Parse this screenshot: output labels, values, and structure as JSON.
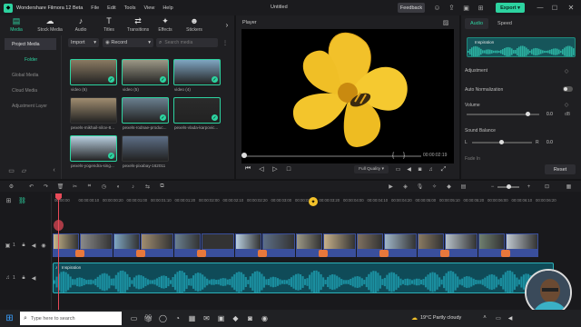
{
  "app": {
    "name": "Wondershare Filmora 12 Beta",
    "doc_title": "Untitled",
    "feedback": "Feedback",
    "export": "Export"
  },
  "menu": [
    "File",
    "Edit",
    "Tools",
    "View",
    "Help"
  ],
  "tabs": [
    {
      "label": "Media",
      "glyph": "▤"
    },
    {
      "label": "Stock Media",
      "glyph": "☁"
    },
    {
      "label": "Audio",
      "glyph": "♪"
    },
    {
      "label": "Titles",
      "glyph": "T"
    },
    {
      "label": "Transitions",
      "glyph": "⇄"
    },
    {
      "label": "Effects",
      "glyph": "✦"
    },
    {
      "label": "Stickers",
      "glyph": "☻"
    }
  ],
  "sidebar": {
    "project_media": "Project Media",
    "folder": "Folder",
    "global_media": "Global Media",
    "cloud_media": "Cloud Media",
    "adjustment_layer": "Adjustment Layer"
  },
  "media_toolbar": {
    "import": "Import",
    "record": "Record",
    "search_placeholder": "Search media"
  },
  "media": [
    {
      "caption": "video (6)",
      "selected": true,
      "color": "#8a7a62"
    },
    {
      "caption": "video (5)",
      "selected": true,
      "color": "#9c9886"
    },
    {
      "caption": "video (4)",
      "selected": true,
      "color": "#7fa6c2"
    },
    {
      "caption": "pexels-mikhail-nilov-8...",
      "selected": false,
      "color": "#a08d70"
    },
    {
      "caption": "pexels-rodnae-produc...",
      "selected": true,
      "color": "#6a7f8f"
    },
    {
      "caption": "pexels-vlada-karpovic...",
      "selected": true,
      "color": "#2b2b2b"
    },
    {
      "caption": "pexels-yogendra-sing...",
      "selected": true,
      "color": "#b9cfe0"
    },
    {
      "caption": "pexels-pixabay-162011",
      "selected": false,
      "color": "#5d6e86"
    }
  ],
  "player": {
    "label": "Player",
    "timecode": "00:00:02:19",
    "quality": "Full Quality"
  },
  "right": {
    "tabs": [
      "Audio",
      "Speed"
    ],
    "clip_name": "Inspiration",
    "adjustment": "Adjustment",
    "auto_normalization": "Auto Normalization",
    "volume": "Volume",
    "volume_value": "0.0",
    "volume_unit": "dB",
    "sound_balance": "Sound Balance",
    "balance_left": "L",
    "balance_right": "R",
    "balance_value": "0.0",
    "fade_in": "Fade In",
    "reset": "Reset"
  },
  "ruler": [
    "00:00:00",
    "00:00:00:10",
    "00:00:00:20",
    "00:00:01:00",
    "00:00:01:10",
    "00:00:01:20",
    "00:00:02:00",
    "00:00:02:10",
    "00:00:02:20",
    "00:00:03:00",
    "00:00:03:10",
    "00:00:03:20",
    "00:00:04:00",
    "00:00:04:10",
    "00:00:04:20",
    "00:00:05:00",
    "00:00:05:10",
    "00:00:05:20",
    "00:00:06:00",
    "00:00:06:10",
    "00:00:06:20"
  ],
  "tracks": {
    "video_label": "1",
    "audio_label": "1",
    "audio_clip": "Inspiration"
  },
  "taskbar": {
    "search_placeholder": "Type here to search",
    "weather": "19°C  Partly cloudy"
  },
  "colors": {
    "accent": "#2dd3a0",
    "audio_wave": "#1b8fa0",
    "audio_bg": "#0f4b58",
    "video_clip": "#3a4f9c",
    "transition": "#e8783c",
    "export_btn": "#2dd3a0",
    "playhead": "#e84a58"
  }
}
